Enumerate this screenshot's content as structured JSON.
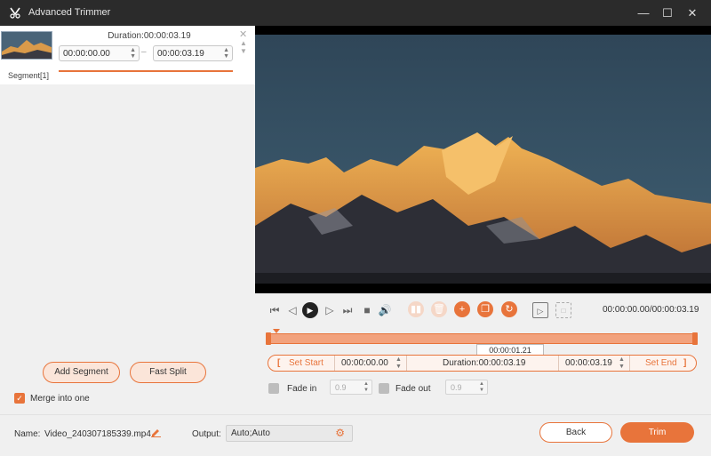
{
  "window": {
    "title": "Advanced Trimmer",
    "minimize": "—",
    "maximize": "☐",
    "close": "✕"
  },
  "segment": {
    "duration": "Duration:00:00:03.19",
    "start": "00:00:00.00",
    "end": "00:00:03.19",
    "dash": "–",
    "label": "Segment[1]"
  },
  "left_actions": {
    "add_segment": "Add Segment",
    "fast_split": "Fast Split",
    "merge_label": "Merge into one",
    "merge_checked": true
  },
  "player": {
    "timecode": "00:00:00.00/00:00:03.19",
    "hover_time": "00:00:01.21"
  },
  "range": {
    "set_start": "Set Start",
    "start": "00:00:00.00",
    "duration": "Duration:00:00:03.19",
    "end": "00:00:03.19",
    "set_end": "Set End",
    "bracket_open": "[",
    "bracket_close": "]"
  },
  "fade": {
    "in_label": "Fade in",
    "in_value": "0.9",
    "out_label": "Fade out",
    "out_value": "0.9"
  },
  "bottom": {
    "name_label": "Name:",
    "name_value": "Video_240307185339.mp4",
    "output_label": "Output:",
    "output_value": "Auto;Auto",
    "back": "Back",
    "trim": "Trim"
  },
  "colors": {
    "accent": "#e8743b",
    "titlebar": "#2b2b2b"
  }
}
